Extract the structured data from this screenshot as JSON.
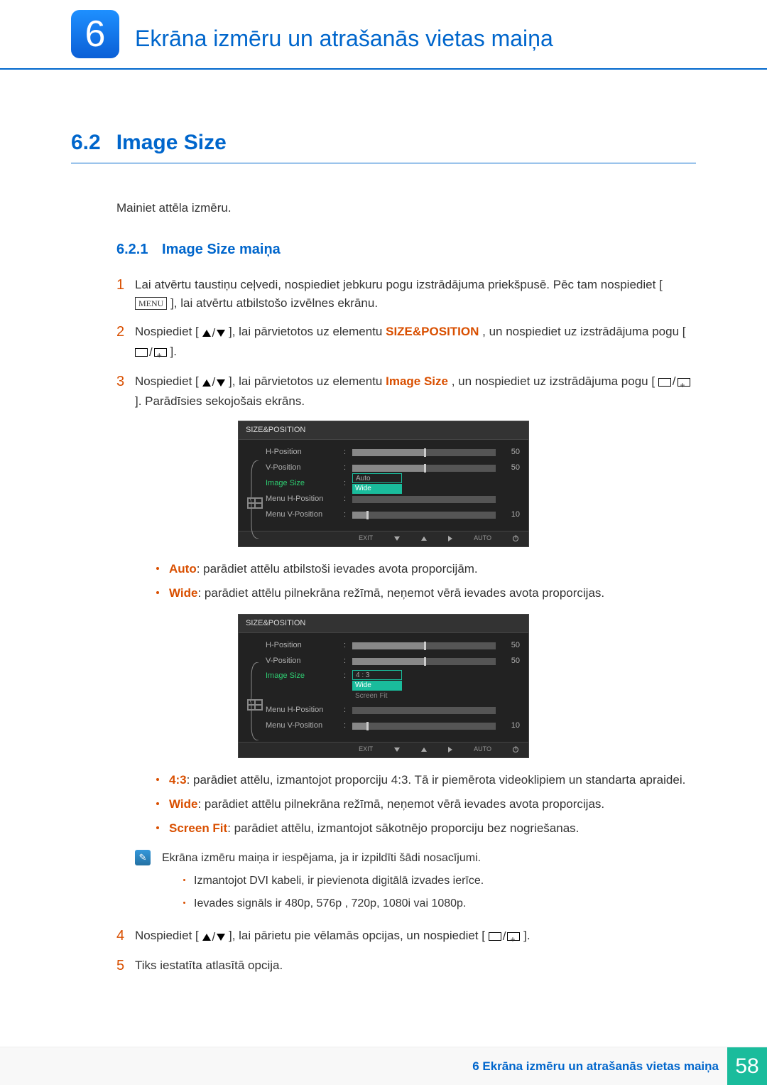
{
  "chapter": {
    "number": "6",
    "title": "Ekrāna izmēru un atrašanās vietas maiņa"
  },
  "section": {
    "number": "6.2",
    "title": "Image Size"
  },
  "intro": "Mainiet attēla izmēru.",
  "subsection": {
    "number": "6.2.1",
    "title": "Image Size maiņa"
  },
  "steps": {
    "s1a": "Lai atvērtu taustiņu ceļvedi, nospiediet jebkuru pogu izstrādājuma priekšpusē. Pēc tam nospiediet [",
    "s1_menu": "MENU",
    "s1b": "], lai atvērtu atbilstošo izvēlnes ekrānu.",
    "s2a": "Nospiediet [",
    "s2b": "], lai pārvietotos uz elementu ",
    "s2_target": "SIZE&POSITION",
    "s2c": ", un nospiediet uz izstrādājuma pogu [",
    "s2d": "].",
    "s3a": "Nospiediet [",
    "s3b": "], lai pārvietotos uz elementu ",
    "s3_target": "Image Size",
    "s3c": ", un nospiediet uz izstrādājuma pogu [",
    "s3d": "]. Parādīsies sekojošais ekrāns.",
    "s4a": "Nospiediet [",
    "s4b": "], lai pārietu pie vēlamās opcijas, un nospiediet [",
    "s4c": "].",
    "s5": "Tiks iestatīta atlasītā opcija."
  },
  "osd1": {
    "title": "SIZE&POSITION",
    "rows": {
      "hpos": "H-Position",
      "hpos_val": "50",
      "vpos": "V-Position",
      "vpos_val": "50",
      "imgsize": "Image Size",
      "opt1": "Auto",
      "opt2": "Wide",
      "mhpos": "Menu H-Position",
      "mvpos": "Menu V-Position",
      "mvpos_val": "10"
    },
    "footer": {
      "exit": "EXIT",
      "auto": "AUTO"
    }
  },
  "bullets1": {
    "auto_label": "Auto",
    "auto_text": ": parādiet attēlu atbilstoši ievades avota proporcijām.",
    "wide_label": "Wide",
    "wide_text": ": parādiet attēlu pilnekrāna režīmā, neņemot vērā ievades avota proporcijas."
  },
  "osd2": {
    "title": "SIZE&POSITION",
    "rows": {
      "hpos": "H-Position",
      "hpos_val": "50",
      "vpos": "V-Position",
      "vpos_val": "50",
      "imgsize": "Image Size",
      "opt1": "4 : 3",
      "opt2": "Wide",
      "opt3": "Screen Fit",
      "mhpos": "Menu H-Position",
      "mvpos": "Menu V-Position",
      "mvpos_val": "10"
    },
    "footer": {
      "exit": "EXIT",
      "auto": "AUTO"
    }
  },
  "bullets2": {
    "r43_label": "4:3",
    "r43_text": ": parādiet attēlu, izmantojot proporciju 4:3. Tā ir piemērota videoklipiem un standarta apraidei.",
    "wide_label": "Wide",
    "wide_text": ": parādiet attēlu pilnekrāna režīmā, neņemot vērā ievades avota proporcijas.",
    "fit_label": "Screen Fit",
    "fit_text": ": parādiet attēlu, izmantojot sākotnējo proporciju bez nogriešanas."
  },
  "note": {
    "intro": "Ekrāna izmēru maiņa ir iespējama, ja ir izpildīti šādi nosacījumi.",
    "n1": "Izmantojot DVI kabeli, ir pievienota digitālā izvades ierīce.",
    "n2": "Ievades signāls ir 480p, 576p , 720p, 1080i vai 1080p."
  },
  "footer": {
    "text": "6 Ekrāna izmēru un atrašanās vietas maiņa",
    "page": "58"
  }
}
